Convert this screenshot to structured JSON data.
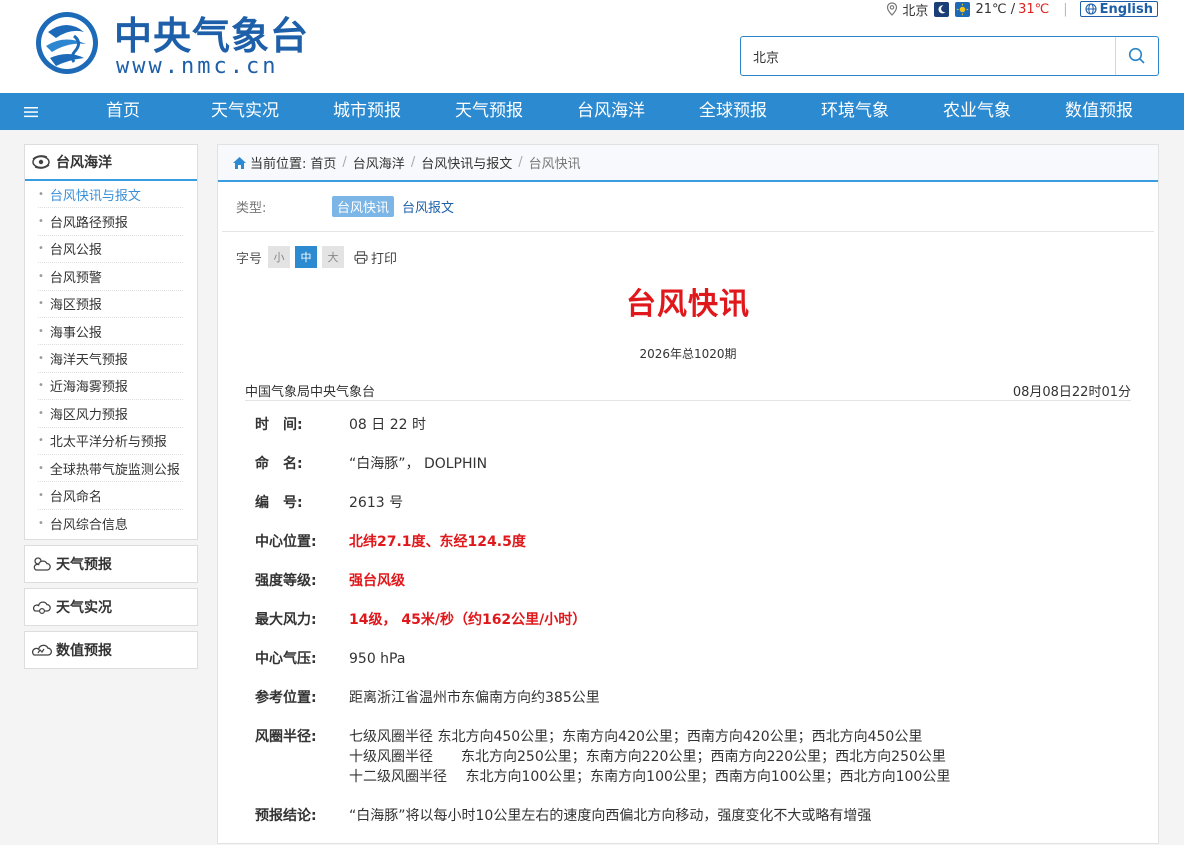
{
  "header": {
    "logo_cn": "中央气象台",
    "logo_url": "www.nmc.cn",
    "city": "北京",
    "temp_low": "21℃ /",
    "temp_high": "31℃",
    "lang_label": "English",
    "search_value": "北京"
  },
  "nav": {
    "items": [
      "首页",
      "天气实况",
      "城市预报",
      "天气预报",
      "台风海洋",
      "全球预报",
      "环境气象",
      "农业气象",
      "数值预报"
    ]
  },
  "sidebar": {
    "section_title": "台风海洋",
    "items": [
      "台风快讯与报文",
      "台风路径预报",
      "台风公报",
      "台风预警",
      "海区预报",
      "海事公报",
      "海洋天气预报",
      "近海海雾预报",
      "海区风力预报",
      "北太平洋分析与预报",
      "全球热带气旋监测公报",
      "台风命名",
      "台风综合信息"
    ],
    "other_sections": [
      "天气预报",
      "天气实况",
      "数值预报"
    ]
  },
  "breadcrumb": {
    "prefix": "当前位置:",
    "crumbs": [
      "首页",
      "台风海洋",
      "台风快讯与报文",
      "台风快讯"
    ]
  },
  "type_filter": {
    "label": "类型:",
    "options": [
      "台风快讯",
      "台风报文"
    ]
  },
  "toolbar": {
    "font_label": "字号",
    "sizes": [
      "小",
      "中",
      "大"
    ],
    "print_label": "打印"
  },
  "document": {
    "title": "台风快讯",
    "issue": "2026年总1020期",
    "issuer": "中国气象局中央气象台",
    "issued_time": "08月08日22时01分",
    "fields": [
      {
        "key": "时　间:",
        "value": "08 日 22 时"
      },
      {
        "key": "命　名:",
        "value": "“白海豚”，  DOLPHIN"
      },
      {
        "key": "编　号:",
        "value": "2613 号"
      },
      {
        "key": "中心位置:",
        "value": "北纬27.1度、东经124.5度"
      },
      {
        "key": "强度等级:",
        "value": "强台风级"
      },
      {
        "key": "最大风力:",
        "value": "14级，  45米/秒（约162公里/小时）"
      },
      {
        "key": "中心气压:",
        "value": "950 hPa"
      },
      {
        "key": "参考位置:",
        "value": "距离浙江省温州市东偏南方向约385公里"
      },
      {
        "key": "风圈半径:",
        "lines": [
          "七级风圈半径 东北方向450公里；东南方向420公里；西南方向420公里；西北方向450公里",
          "十级风圈半径　　东北方向250公里；东南方向220公里；西南方向220公里；西北方向250公里",
          "十二级风圈半径　 东北方向100公里；东南方向100公里；西南方向100公里；西北方向100公里"
        ]
      },
      {
        "key": "预报结论:",
        "value": "“白海豚”将以每小时10公里左右的速度向西偏北方向移动，强度变化不大或略有增强"
      }
    ]
  },
  "colors": {
    "nav_bg": "#2c8ad1",
    "brand": "#1d5fa8",
    "alert_red": "#e0181b",
    "accent_blue": "#3a9de0"
  }
}
